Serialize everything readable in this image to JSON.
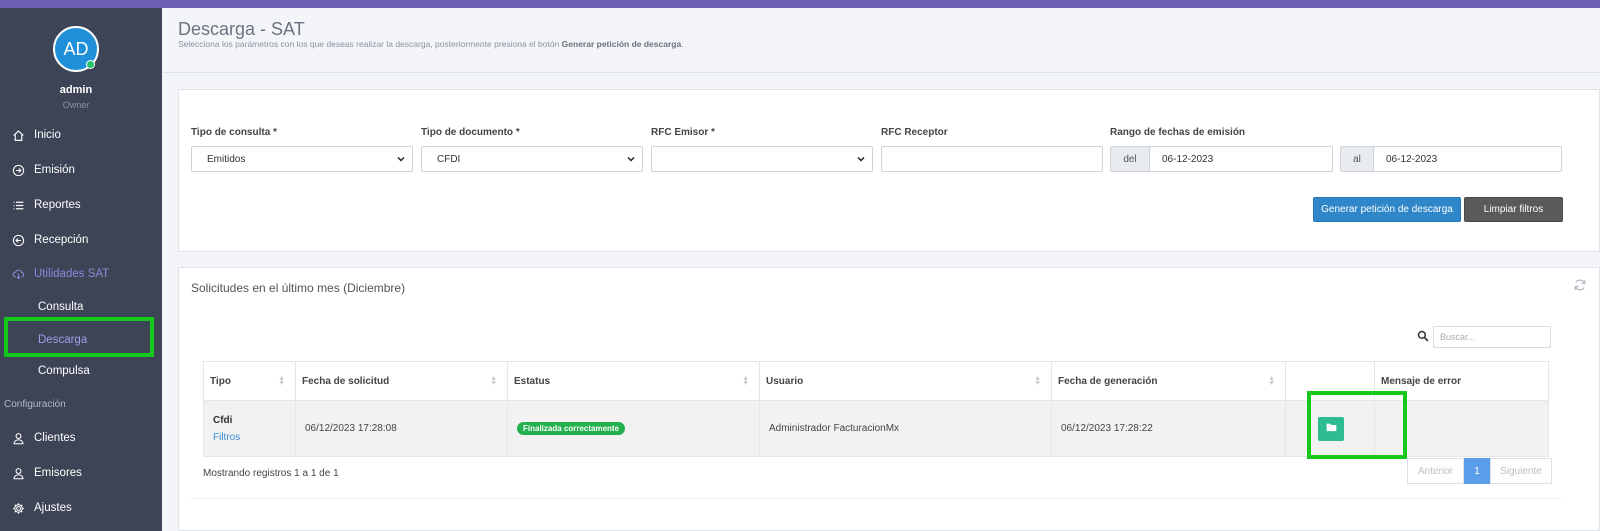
{
  "sidebar": {
    "avatar_initials": "AD",
    "user_name": "admin",
    "user_role": "Owner",
    "items": [
      {
        "label": "Inicio",
        "icon": "home-icon"
      },
      {
        "label": "Emisión",
        "icon": "arrow-circle-right-icon"
      },
      {
        "label": "Reportes",
        "icon": "list-icon"
      },
      {
        "label": "Recepción",
        "icon": "arrow-circle-left-icon"
      },
      {
        "label": "Utilidades SAT",
        "icon": "cloud-download-icon"
      }
    ],
    "sub_items": [
      {
        "label": "Consulta"
      },
      {
        "label": "Descarga"
      },
      {
        "label": "Compulsa"
      }
    ],
    "section_label": "Configuración",
    "config_items": [
      {
        "label": "Clientes",
        "icon": "user-icon"
      },
      {
        "label": "Emisores",
        "icon": "user-icon"
      },
      {
        "label": "Ajustes",
        "icon": "gear-icon"
      }
    ]
  },
  "header": {
    "title": "Descarga - SAT",
    "subtitle_pre": "Selecciona los parámetros con los que deseas realizar la descarga, posteriormente presiona el botón ",
    "subtitle_bold": "Generar petición de descarga",
    "subtitle_post": "."
  },
  "filters": {
    "tipo_consulta_label": "Tipo de consulta *",
    "tipo_consulta_value": "Emitidos",
    "tipo_documento_label": "Tipo de documento *",
    "tipo_documento_value": "CFDI",
    "rfc_emisor_label": "RFC Emisor *",
    "rfc_emisor_value": "",
    "rfc_receptor_label": "RFC Receptor",
    "rfc_receptor_value": "",
    "rango_label": "Rango de fechas de emisión",
    "del_label": "del",
    "del_value": "06-12-2023",
    "al_label": "al",
    "al_value": "06-12-2023",
    "generate_button": "Generar petición de descarga",
    "clear_button": "Limpiar filtros"
  },
  "requests": {
    "title": "Solicitudes en el último mes (Diciembre)",
    "search_placeholder": "Buscar...",
    "columns": [
      "Tipo",
      "Fecha de solicitud",
      "Estatus",
      "Usuario",
      "Fecha de generación",
      "",
      "Mensaje de error"
    ],
    "rows": [
      {
        "tipo": "Cfdi",
        "tipo_link": "Filtros",
        "fecha_solicitud": "06/12/2023 17:28:08",
        "estatus": "Finalizada correctamente",
        "usuario": "Administrador FacturacionMx",
        "fecha_generacion": "06/12/2023 17:28:22",
        "mensaje_error": ""
      }
    ],
    "showing": "Mostrando registros 1 a 1 de 1",
    "pager": {
      "prev": "Anterior",
      "current": "1",
      "next": "Siguiente"
    }
  },
  "colors": {
    "accent": "#6a5fb0",
    "sidebar_bg": "#3d4456",
    "primary_button": "#2f86c9",
    "success": "#22b14c",
    "highlight": "#15c81a"
  }
}
